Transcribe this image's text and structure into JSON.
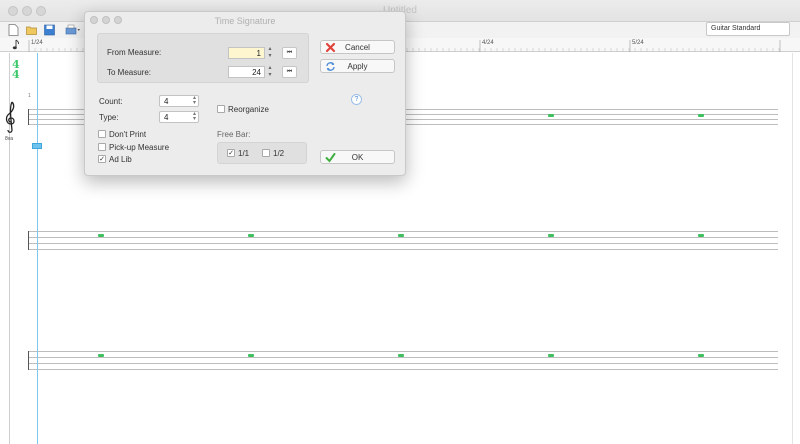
{
  "main_window": {
    "title": "Untitled",
    "instrument_select": "Guitar Standard"
  },
  "ruler": {
    "labels": [
      "1/24",
      "4/24",
      "5/24"
    ]
  },
  "score": {
    "time_signature": {
      "top": "4",
      "bottom": "4"
    },
    "measure_number": "1",
    "clef_subscript": "8va"
  },
  "dialog": {
    "title": "Time Signature",
    "from_measure_label": "From Measure:",
    "from_measure_value": "1",
    "to_measure_label": "To Measure:",
    "to_measure_value": "24",
    "nav_glyph": "⏮",
    "count_label": "Count:",
    "count_value": "4",
    "type_label": "Type:",
    "type_value": "4",
    "reorganize_label": "Reorganize",
    "dont_print_label": "Don't Print",
    "pickup_label": "Pick-up Measure",
    "ad_lib_label": "Ad Lib",
    "free_bar_label": "Free Bar:",
    "free_bar_1_1": "1/1",
    "free_bar_1_2": "1/2",
    "check_glyph": "✓",
    "cancel_label": "Cancel",
    "apply_label": "Apply",
    "ok_label": "OK",
    "help_glyph": "?",
    "colors": {
      "cancel_icon": "#e0443c",
      "apply_icon": "#4f8fd8",
      "ok_icon": "#3fae3f",
      "accent_mark": "#40c060"
    }
  }
}
